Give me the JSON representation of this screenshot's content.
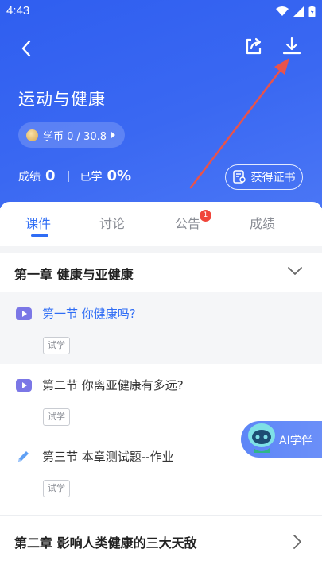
{
  "status_bar": {
    "time": "4:43"
  },
  "course": {
    "title": "运动与健康",
    "coin_label": "学币 0 / 30.8",
    "score_label": "成绩",
    "score_value": "0",
    "learned_label": "已学",
    "learned_value": "0%",
    "certificate_button": "获得证书"
  },
  "tabs": [
    {
      "label": "课件",
      "active": true
    },
    {
      "label": "讨论",
      "active": false
    },
    {
      "label": "公告",
      "active": false,
      "badge": "1"
    },
    {
      "label": "成绩",
      "active": false
    }
  ],
  "chapters": [
    {
      "name": "第一章  健康与亚健康",
      "expanded": true,
      "lessons": [
        {
          "name": "第一节  你健康吗?",
          "tag": "试学",
          "icon": "video-icon",
          "current": true
        },
        {
          "name": "第二节  你离亚健康有多远?",
          "tag": "试学",
          "icon": "video-icon",
          "current": false
        },
        {
          "name": "第三节  本章测试题--作业",
          "tag": "试学",
          "icon": "pencil-icon",
          "current": false
        }
      ]
    },
    {
      "name": "第二章  影响人类健康的三大天敌",
      "expanded": false
    }
  ],
  "ai_assistant": {
    "label": "AI学伴"
  },
  "colors": {
    "header": "#2f5ef0",
    "accent": "#2f6df5",
    "badge": "#f0453a",
    "annotation_arrow": "#e8534b"
  }
}
